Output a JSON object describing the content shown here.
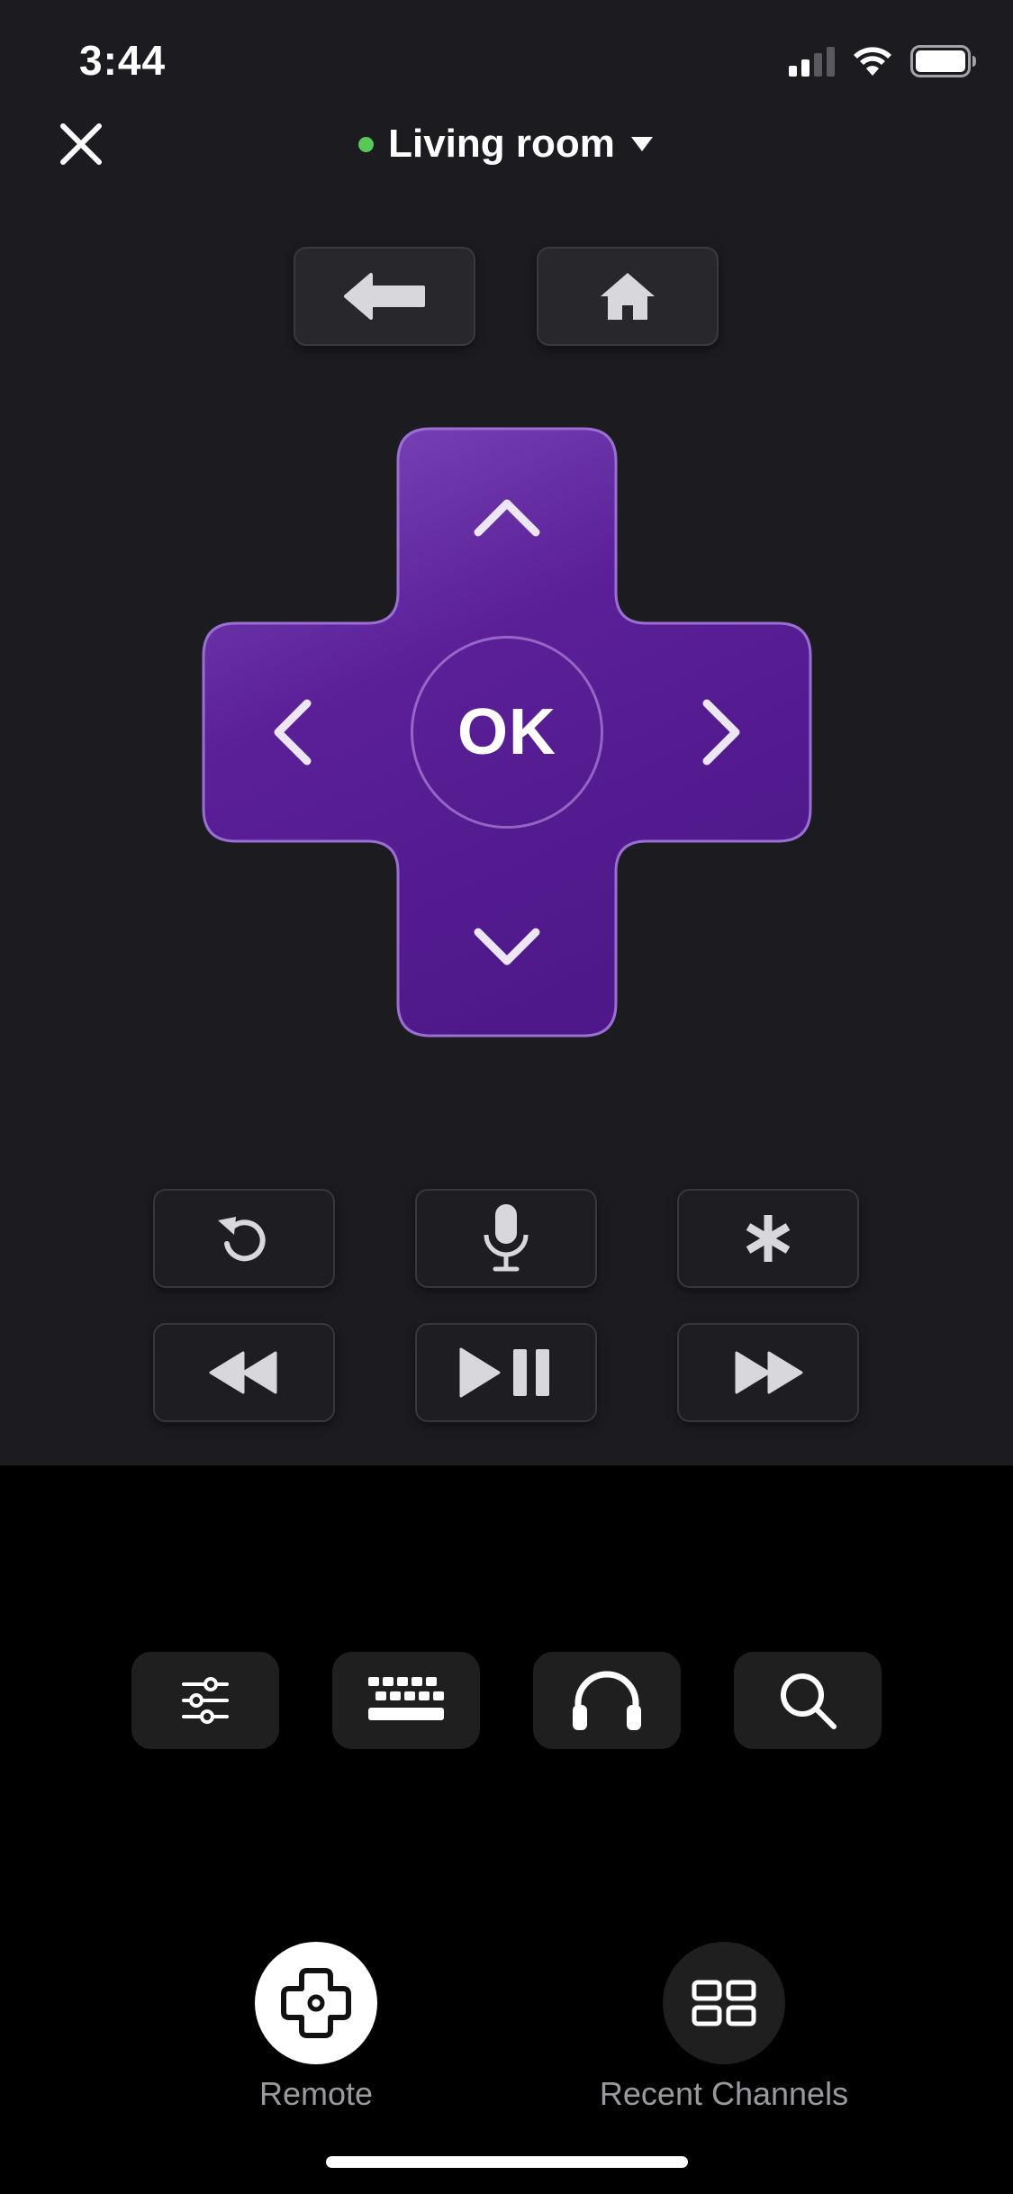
{
  "status_bar": {
    "time": "3:44",
    "icons": [
      "cellular-signal-icon",
      "wifi-icon",
      "battery-icon"
    ]
  },
  "header": {
    "close_icon": "close-icon",
    "device_name": "Living room",
    "device_status_color": "#58c957",
    "dropdown_icon": "caret-down-icon"
  },
  "top_keys": [
    {
      "icon": "back-arrow-icon"
    },
    {
      "icon": "home-icon"
    }
  ],
  "dpad": {
    "ok_label": "OK",
    "colors": {
      "top": "#7a45b8",
      "bottom": "#4f1a8a",
      "edge": "#8b5fc8"
    },
    "icons": [
      "chevron-up-icon",
      "chevron-left-icon",
      "chevron-right-icon",
      "chevron-down-icon"
    ]
  },
  "media_keys": [
    {
      "icon": "replay-icon"
    },
    {
      "icon": "microphone-icon"
    },
    {
      "icon": "asterisk-icon"
    },
    {
      "icon": "rewind-icon"
    },
    {
      "icon": "play-pause-icon"
    },
    {
      "icon": "fast-forward-icon"
    }
  ],
  "utility_bar": [
    {
      "icon": "sliders-icon"
    },
    {
      "icon": "keyboard-icon"
    },
    {
      "icon": "headphones-icon"
    },
    {
      "icon": "search-icon"
    }
  ],
  "bottom_nav": {
    "items": [
      {
        "label": "Remote",
        "icon": "dpad-icon",
        "active": true
      },
      {
        "label": "Recent Channels",
        "icon": "grid-icon",
        "active": false
      }
    ]
  },
  "theme": {
    "remote_bg": "#1c1b20",
    "page_bg": "#000000",
    "accent": "#6a2fa8"
  }
}
